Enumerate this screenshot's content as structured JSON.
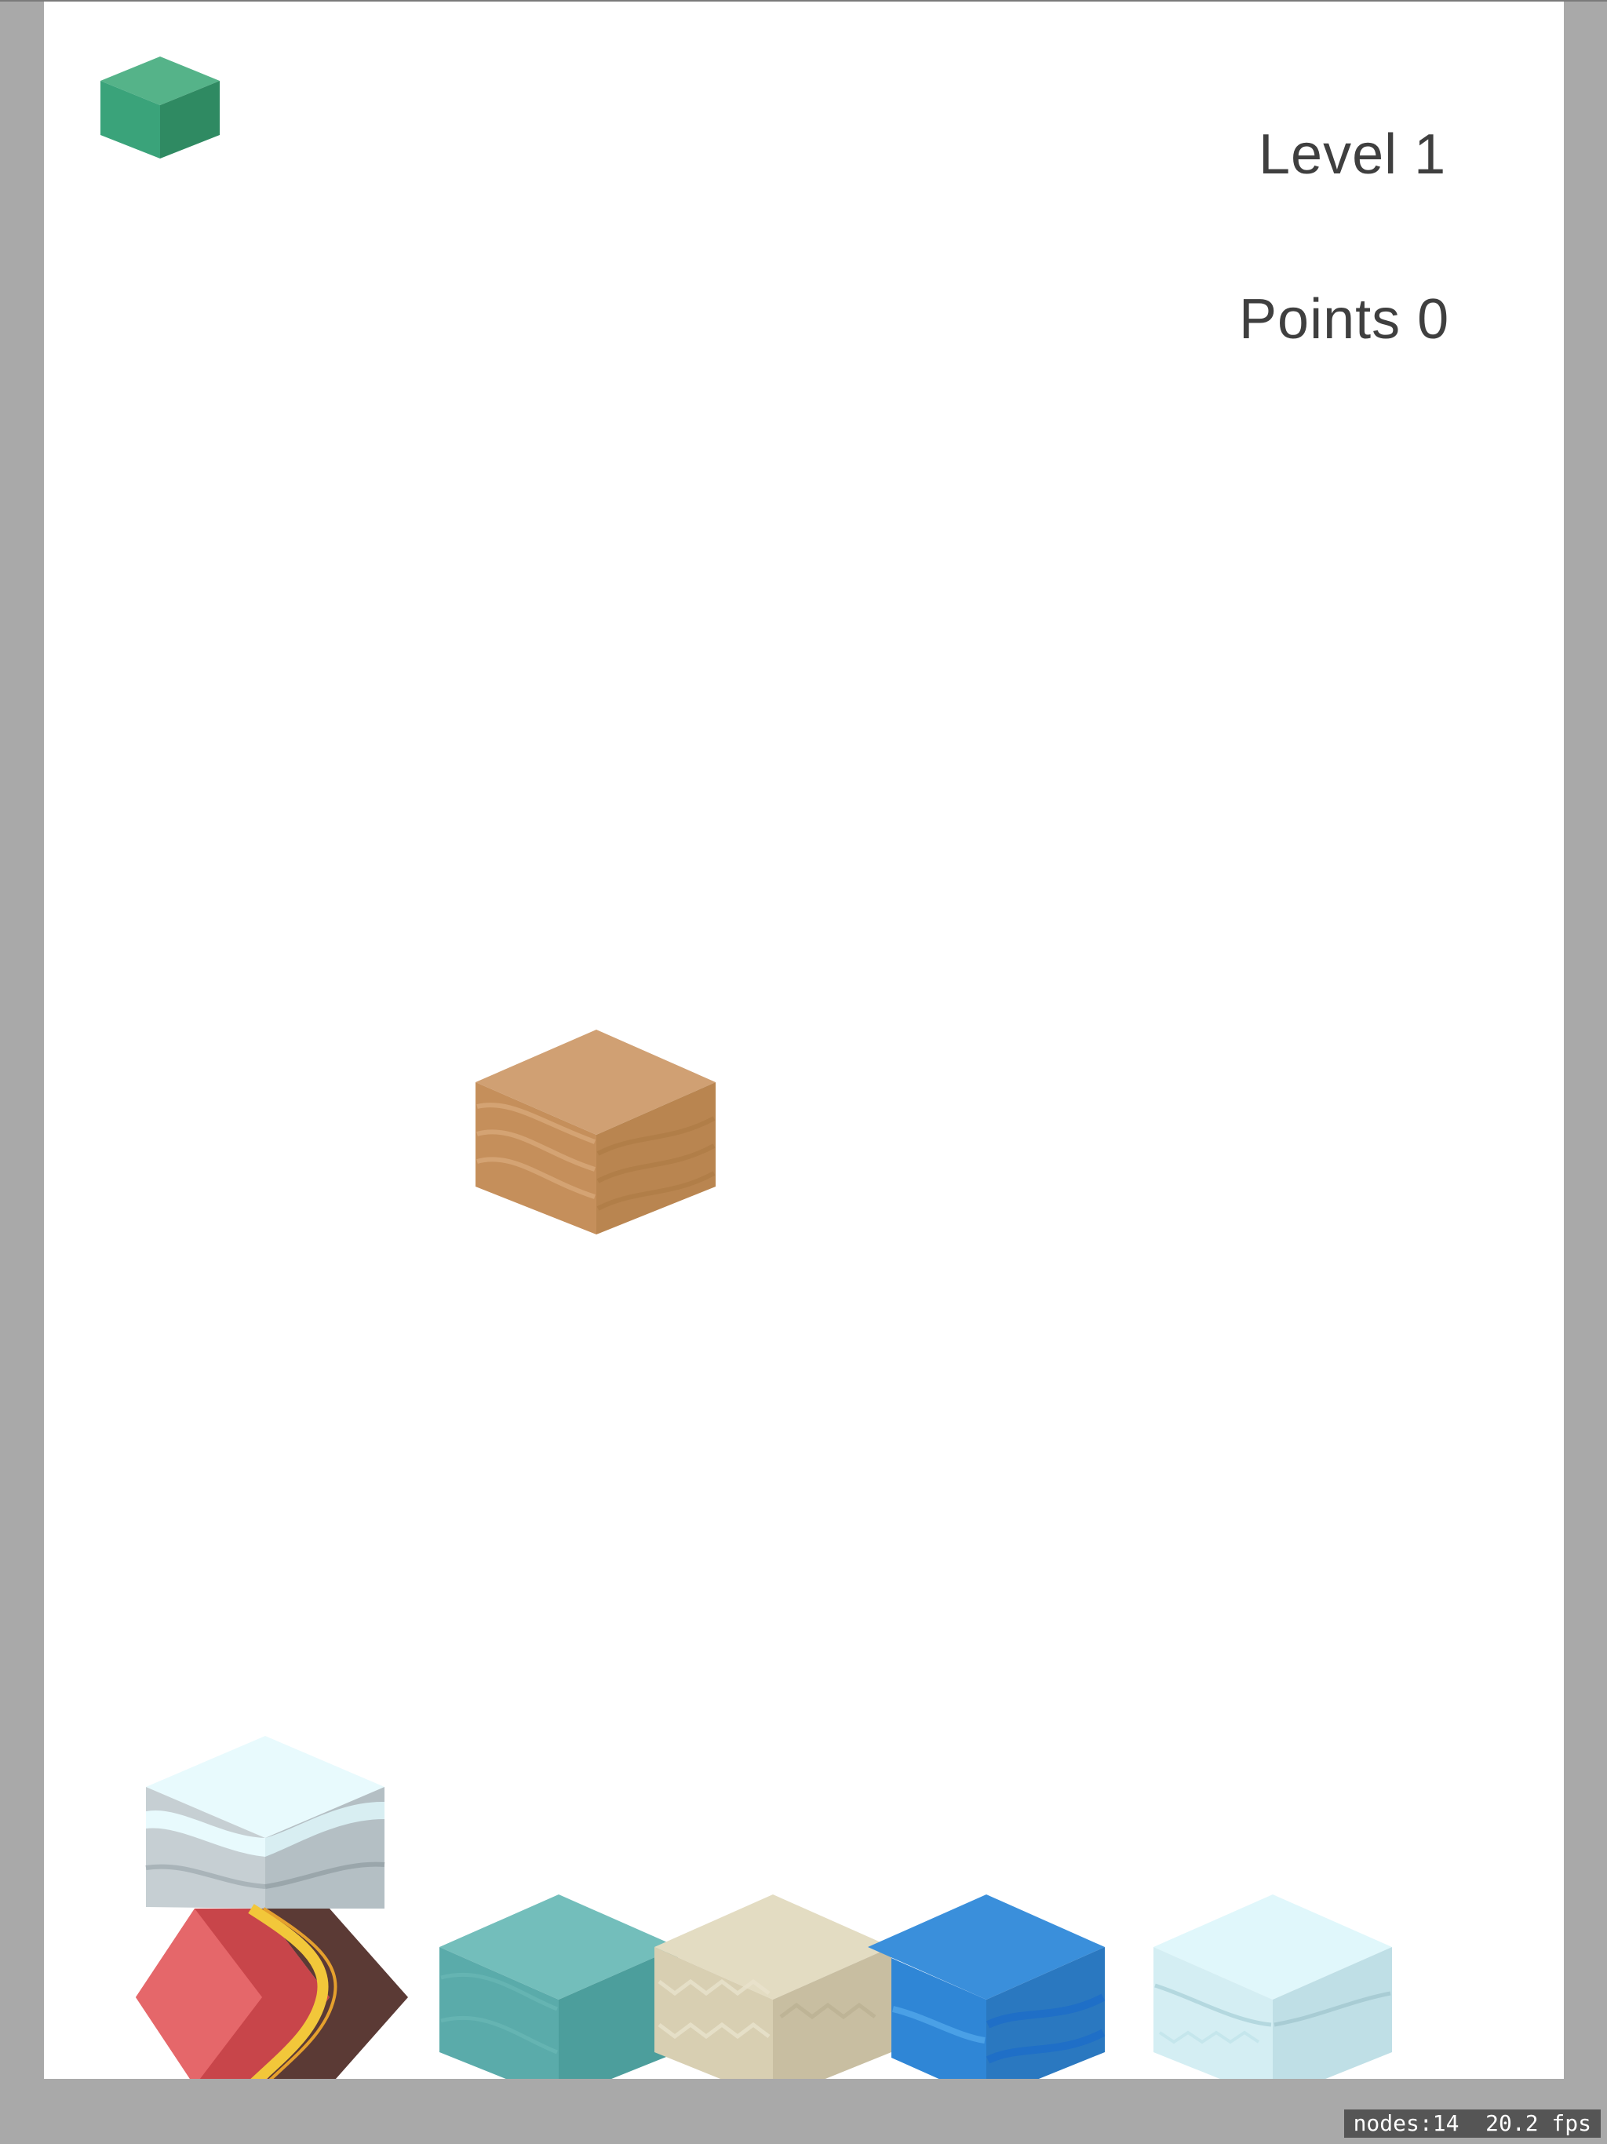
{
  "hud": {
    "level_text": "Level 1",
    "points_text": "Points 0"
  },
  "debug": {
    "stats_text": "nodes:14  20.2 fps"
  },
  "palette": {
    "background": "#ffffff",
    "frame": "#a9a9a9",
    "green_block": "#3aa37a",
    "wood_block": "#c7935f",
    "snow_block": "#e6f9fd",
    "lava_block": "#e25456",
    "teal_block": "#5fb3b0",
    "sand_block": "#e3dcc2",
    "water_block": "#2f86d6",
    "ice_block": "#dff6fb"
  },
  "blocks": [
    {
      "name": "next-block-preview-green",
      "kind": "grass"
    },
    {
      "name": "falling-wood-block",
      "kind": "wood"
    },
    {
      "name": "stacked-snow-block",
      "kind": "snow"
    },
    {
      "name": "stacked-lava-block",
      "kind": "lava"
    },
    {
      "name": "stacked-teal-block",
      "kind": "teal"
    },
    {
      "name": "stacked-sand-block",
      "kind": "sand"
    },
    {
      "name": "stacked-water-block",
      "kind": "water"
    },
    {
      "name": "stacked-ice-block",
      "kind": "ice"
    }
  ]
}
